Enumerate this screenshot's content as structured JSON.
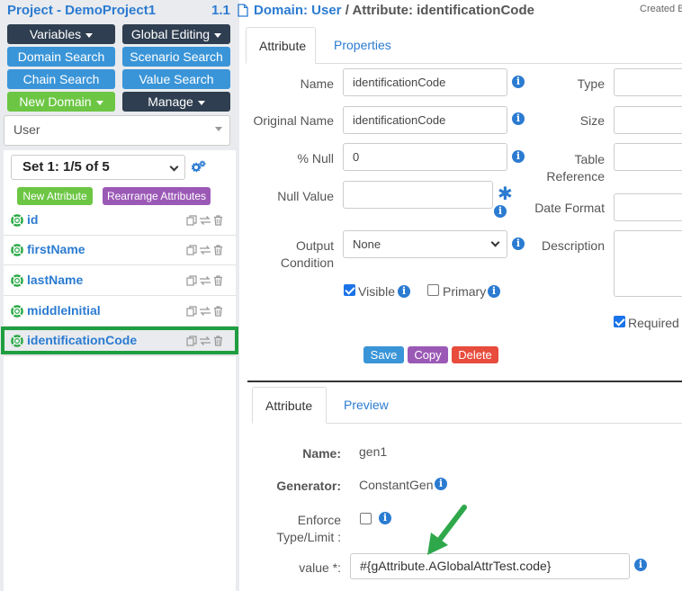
{
  "sidebar": {
    "project_title": "Project - DemoProject1",
    "version": "1.1",
    "buttons": {
      "variables": "Variables",
      "global_editing": "Global Editing",
      "domain_search": "Domain Search",
      "scenario_search": "Scenario Search",
      "chain_search": "Chain Search",
      "value_search": "Value Search",
      "new_domain": "New Domain",
      "manage": "Manage"
    },
    "domain_select": "User",
    "set_select": "Set 1: 1/5 of 5",
    "new_attribute": "New Attribute",
    "rearrange_attributes": "Rearrange Attributes",
    "attributes": [
      {
        "name": "id"
      },
      {
        "name": "firstName"
      },
      {
        "name": "lastName"
      },
      {
        "name": "middleInitial"
      },
      {
        "name": "identificationCode"
      }
    ]
  },
  "header": {
    "domain_crumb": "Domain: User",
    "attribute_crumb": " / Attribute: identificationCode",
    "created": "Created B"
  },
  "attr_tabs": {
    "attribute": "Attribute",
    "properties": "Properties"
  },
  "form": {
    "name_label": "Name",
    "name_value": "identificationCode",
    "original_name_label": "Original Name",
    "original_name_value": "identificationCode",
    "null_pct_label": "% Null",
    "null_pct_value": "0",
    "null_value_label": "Null Value",
    "null_value_value": "",
    "output_condition_label": "Output Condition",
    "output_condition_value": "None",
    "visible_label": "Visible",
    "primary_label": "Primary",
    "type_label": "Type",
    "size_label": "Size",
    "table_reference_label": "Table Reference",
    "date_format_label": "Date Format",
    "description_label": "Description",
    "required_label": "Required",
    "save": "Save",
    "copy": "Copy",
    "delete": "Delete"
  },
  "gen_tabs": {
    "attribute": "Attribute",
    "preview": "Preview"
  },
  "generator": {
    "name_label": "Name:",
    "name_value": "gen1",
    "generator_label": "Generator:",
    "generator_value": "ConstantGen",
    "enforce_label": "Enforce Type/Limit :",
    "value_label": "value *:",
    "value_value": "#{gAttribute.AGlobalAttrTest.code}"
  },
  "colors": {
    "accent": "#2b7bd1",
    "dark_button": "#2f3e50",
    "blue_button": "#3a95d8",
    "green_button": "#6cc644",
    "purple_button": "#9b59b6",
    "red_button": "#e74c3c",
    "highlight": "#1f9e40"
  },
  "icons": [
    "gears-icon",
    "lifebuoy-icon",
    "copy-icon",
    "swap-icon",
    "trash-icon",
    "info-icon",
    "file-icon",
    "green-arrow-icon"
  ]
}
